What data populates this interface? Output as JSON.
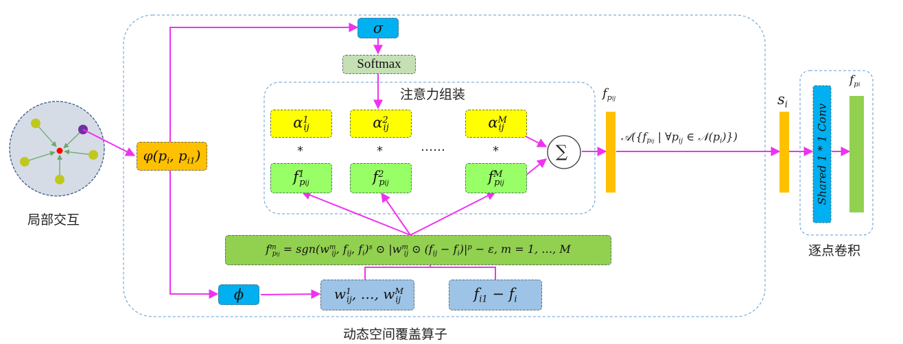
{
  "labels": {
    "local_interaction": "局部交互",
    "attention_assembly": "注意力组装",
    "dynamic_operator": "动态空间覆盖算子",
    "pointwise_conv": "逐点卷积"
  },
  "nodes": {
    "phi_func": "φ(p_i, p_i1)",
    "sigma": "σ",
    "softmax": "Softmax",
    "alpha_1": "α_ij^1",
    "alpha_2": "α_ij^2",
    "alpha_m": "α_ij^M",
    "star": "*",
    "ellipsis": "……",
    "f_1": "f_pij^1",
    "f_2": "f_pij^2",
    "f_m": "f_pij^M",
    "sum": "∑",
    "f_pij_label": "f_pij",
    "aggregate": "𝒜({f_pij | ∀p_ij ∈ 𝒩(p_i)})",
    "s_i": "s_i",
    "formula": "f_pij^m = sgn(w_ij^m, f_ij, f_i)^s ⊙ |w_ij^m ⊙ (f_ij − f_i)|^p − ε, m = 1, …, M",
    "phi_small": "ϕ",
    "w_set": "w_ij^1, …, w_ij^M",
    "diff": "f_i1 − f_i",
    "conv_bar": "Shared 1 * 1 Conv",
    "f_pi": "f_pi"
  },
  "colors": {
    "edge": "#ee33ee",
    "yellow": "#ffff00",
    "green": "#99ff66",
    "orange": "#ffc000",
    "cyan": "#00b0f0",
    "light_blue": "#9dc3e6",
    "olive": "#92d050",
    "softmax": "#c5e0b4",
    "group_border": "#5b9bd5"
  }
}
